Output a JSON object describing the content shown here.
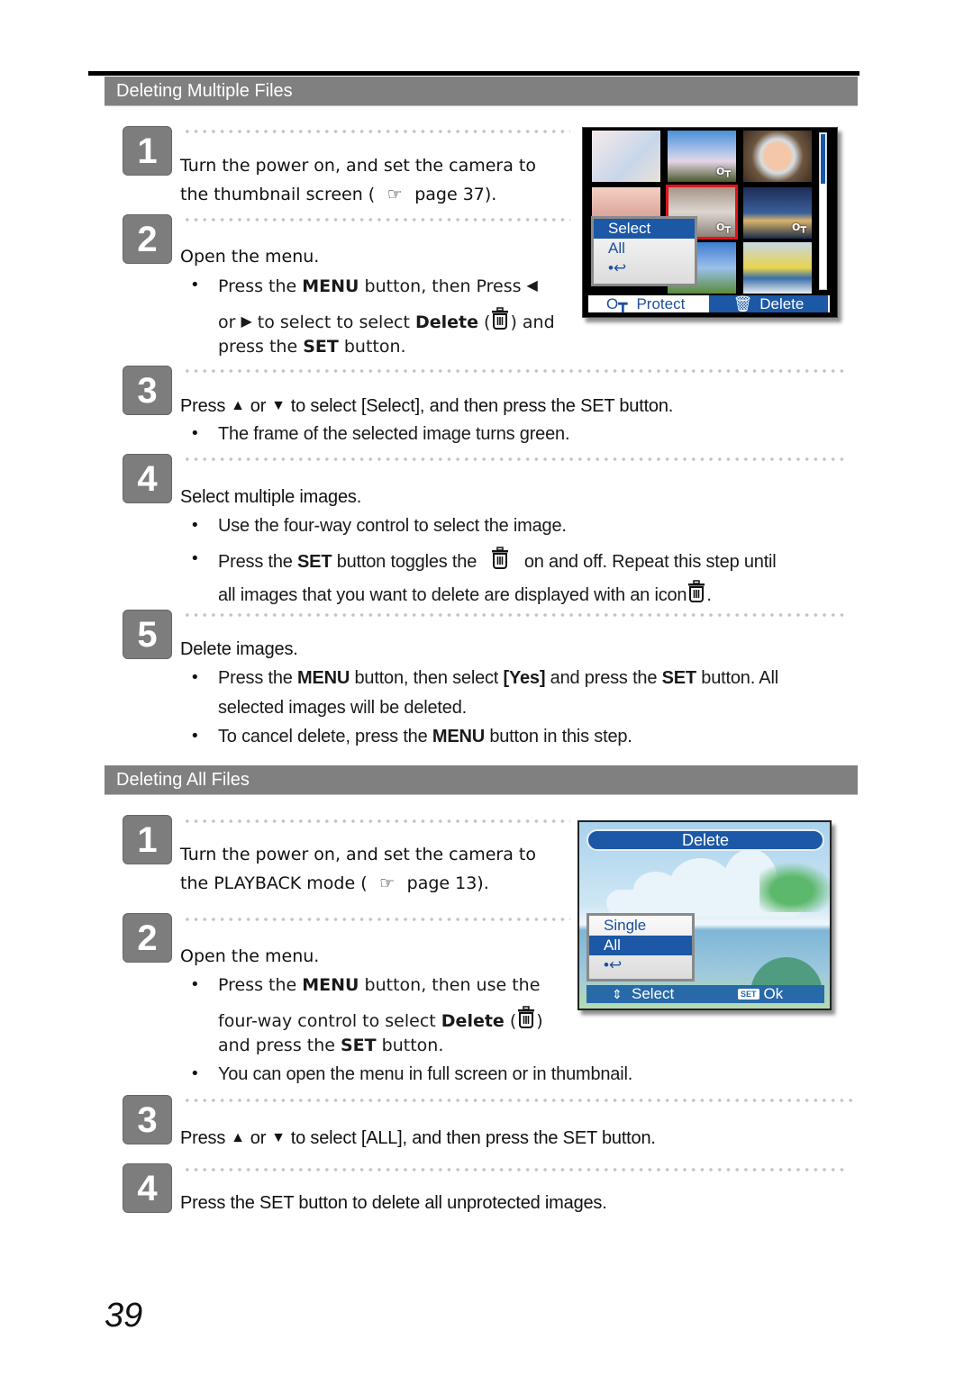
{
  "sections": [
    {
      "title": "Deleting Multiple Files",
      "steps": [
        {
          "number": "1",
          "heading_line1": "Turn the power on, and set the camera to",
          "heading_line2_pre": "the thumbnail screen (",
          "heading_line2_post": "page 37)."
        },
        {
          "number": "2",
          "heading": "Open the menu.",
          "bullet1_line1_pre": "Press the ",
          "bullet1_line1_kw": "MENU",
          "bullet1_line1_post": " button, then Press",
          "bullet1_line2_pre": "or",
          "bullet1_line2_mid": "to select to select ",
          "bullet1_line2_kw": "Delete",
          "bullet1_line2_open": " (",
          "bullet1_line2_post": ") and",
          "bullet1_line3_pre": "press the ",
          "bullet1_line3_kw": "SET",
          "bullet1_line3_post": " button."
        },
        {
          "number": "3",
          "heading_pre": "Press",
          "heading_or": "or",
          "heading_post": "to select [Select], and then press the SET button.",
          "bullet1": "The frame of the selected image turns green."
        },
        {
          "number": "4",
          "heading": "Select multiple images.",
          "bullet1": "Use the four-way control to select the image.",
          "bullet2_line1_pre": "Press the ",
          "bullet2_line1_kw": "SET",
          "bullet2_line1_mid": " button toggles the",
          "bullet2_line1_post": "on and off. Repeat this step until",
          "bullet2_line2_pre": "all images that you want to delete are displayed with an icon",
          "bullet2_line2_post": "."
        },
        {
          "number": "5",
          "heading": "Delete images.",
          "bullet1_line1_pre": "Press the ",
          "bullet1_line1_kw1": "MENU",
          "bullet1_line1_mid": " button, then select ",
          "bullet1_line1_kw2": "[Yes]",
          "bullet1_line1_mid2": " and press the ",
          "bullet1_line1_kw3": "SET",
          "bullet1_line1_post": " button. All",
          "bullet1_line2": "selected images will be deleted.",
          "bullet2_pre": "To cancel delete, press the ",
          "bullet2_kw": "MENU",
          "bullet2_post": " button in this step."
        }
      ]
    },
    {
      "title": "Deleting All Files",
      "steps": [
        {
          "number": "1",
          "heading_line1": "Turn the power on, and set the camera to",
          "heading_line2_pre": "the PLAYBACK mode (",
          "heading_line2_post": "page 13)."
        },
        {
          "number": "2",
          "heading": "Open the menu.",
          "bullet1_line1_pre": "Press the ",
          "bullet1_line1_kw": "MENU",
          "bullet1_line1_post": " button, then use the",
          "bullet1_line2_pre": "four-way control to select ",
          "bullet1_line2_kw": "Delete",
          "bullet1_line2_open": " (",
          "bullet1_line2_post": ")",
          "bullet1_line3_pre": "and press the ",
          "bullet1_line3_kw": "SET",
          "bullet1_line3_post": " button.",
          "bullet2": "You can open the menu in full screen or in thumbnail."
        },
        {
          "number": "3",
          "heading_pre": "Press",
          "heading_or": "or",
          "heading_post": "to select [ALL], and then press the SET button."
        },
        {
          "number": "4",
          "heading": "Press the SET button to delete all unprotected images."
        }
      ]
    }
  ],
  "camera_thumbnail_screen": {
    "menu_items": [
      "Select",
      "All",
      "•↩"
    ],
    "selected_menu_item": "Select",
    "bottom_protect_label": "Protect",
    "bottom_delete_label": "Delete",
    "selected_thumbnail_frame_color": "#e0141a",
    "highlight_color": "#1c58a6"
  },
  "camera_delete_screen": {
    "title": "Delete",
    "menu_items": [
      "Single",
      "All",
      "•↩"
    ],
    "selected_menu_item": "All",
    "bottom_select_label": "Select",
    "bottom_set_chip": "SET",
    "bottom_ok_label": "Ok"
  },
  "icons": {
    "hand_pointer": "☞",
    "triangle_left": "◀",
    "triangle_right": "▶",
    "triangle_up": "▲",
    "triangle_down": "▼",
    "key": "O┳",
    "updown": "⇕"
  },
  "page_number": "39"
}
